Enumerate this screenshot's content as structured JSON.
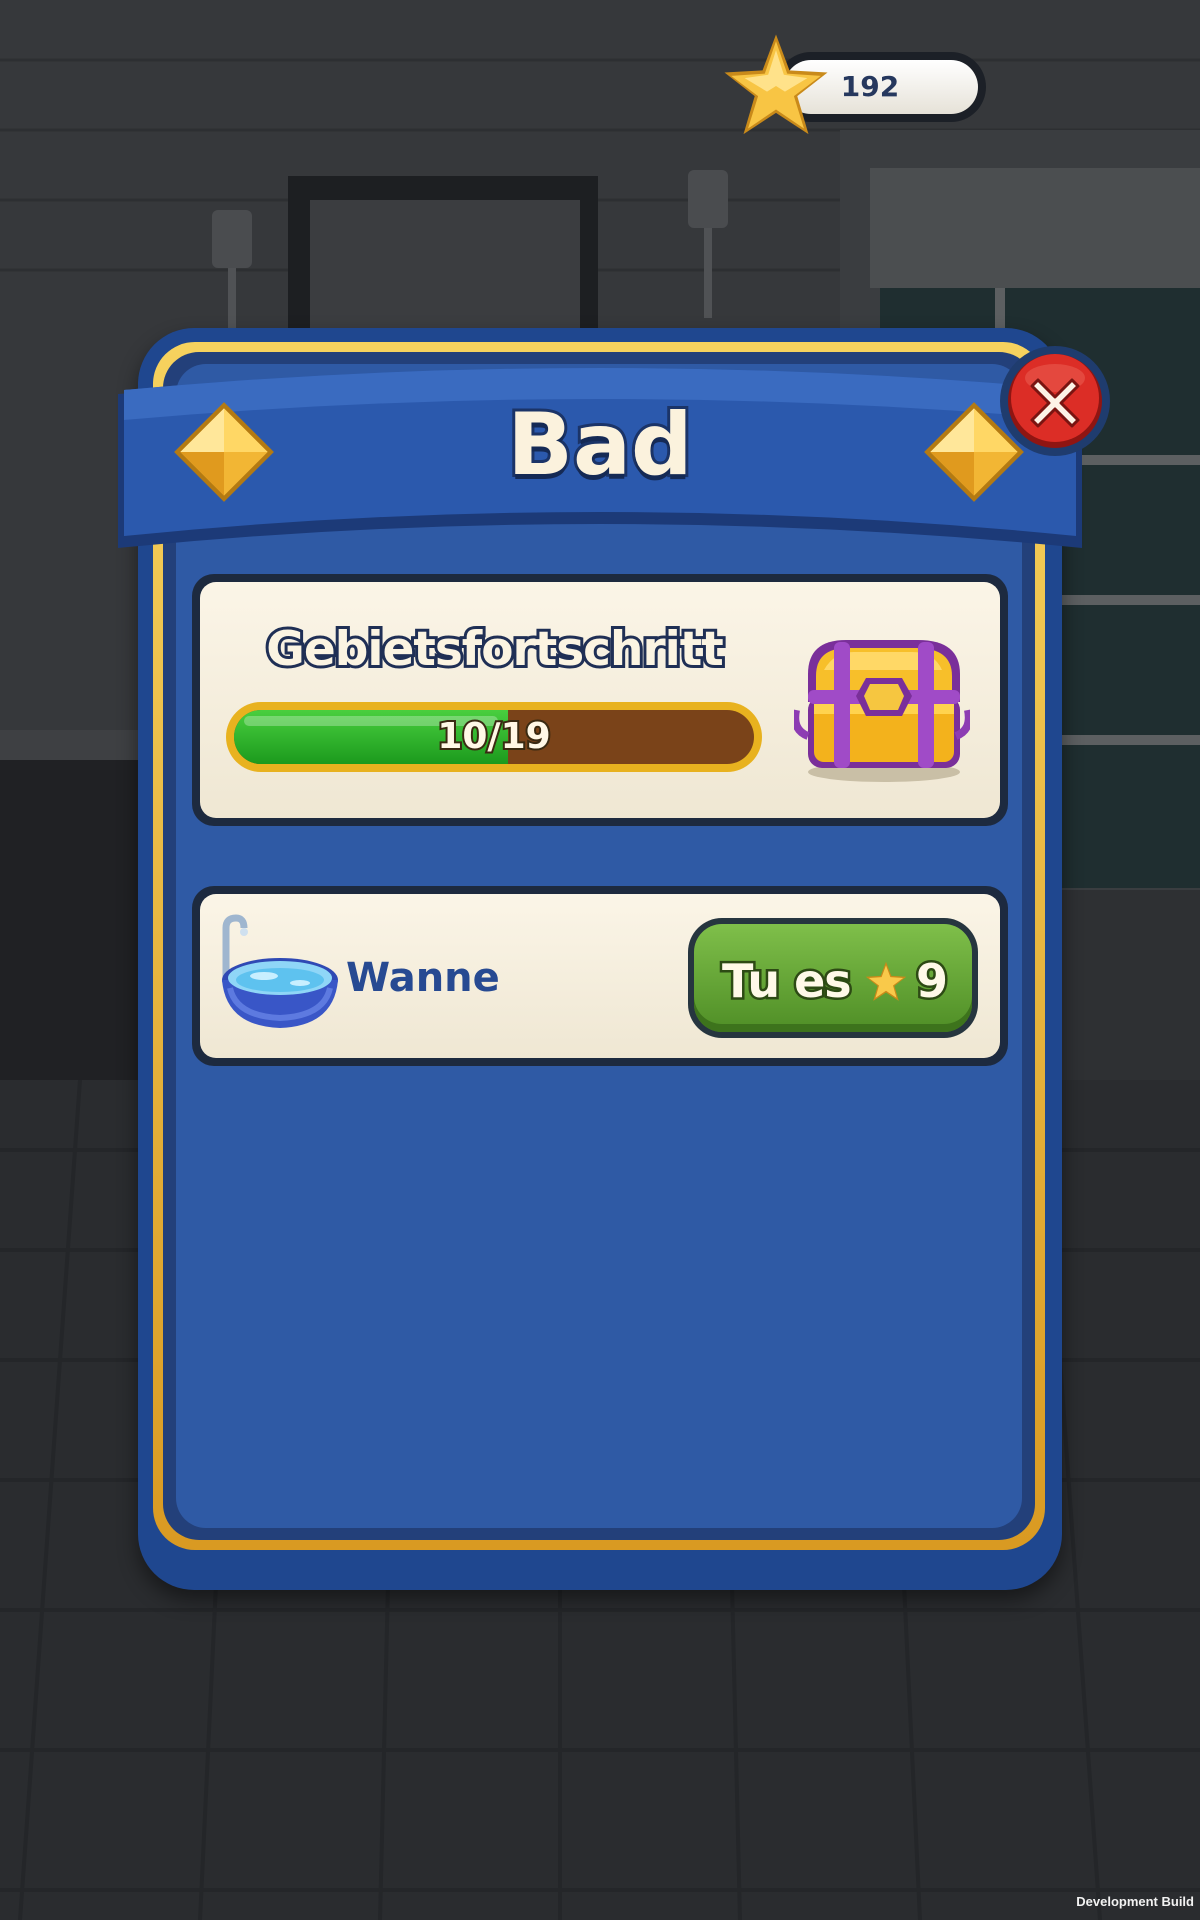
{
  "hud": {
    "stars": "192"
  },
  "panel": {
    "title": "Bad",
    "progress": {
      "title": "Gebietsfortschritt",
      "text": "10/19",
      "current": 10,
      "total": 19
    },
    "tasks": [
      {
        "label": "Wanne",
        "button_label": "Tu es",
        "cost": "9",
        "icon": "bathtub-icon"
      }
    ]
  },
  "footer": {
    "build_label": "Development Build"
  },
  "colors": {
    "panel_blue": "#2f5aa5",
    "gold_frame": "#e8b21f",
    "progress_green": "#2cb02c",
    "button_green": "#6aa63a",
    "close_red": "#d92b25"
  }
}
